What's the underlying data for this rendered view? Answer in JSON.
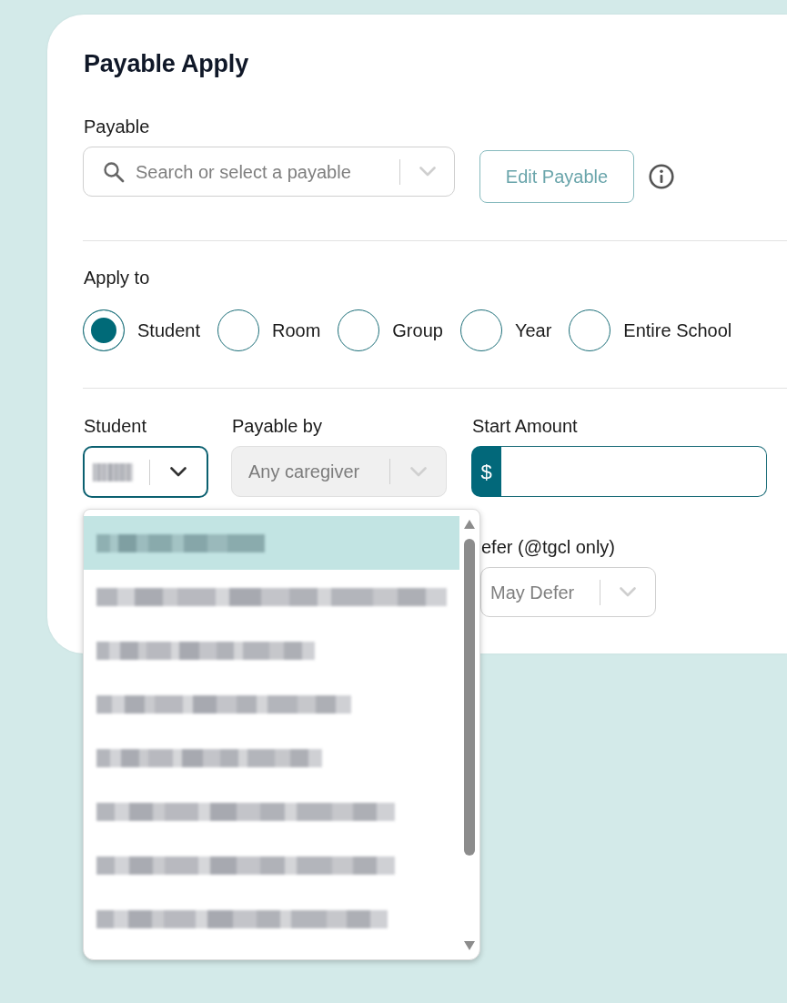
{
  "title": "Payable Apply",
  "payable": {
    "label": "Payable",
    "placeholder": "Search or select a payable",
    "edit_button": "Edit Payable"
  },
  "apply_to": {
    "label": "Apply to",
    "options": [
      {
        "label": "Student",
        "selected": true
      },
      {
        "label": "Room",
        "selected": false
      },
      {
        "label": "Group",
        "selected": false
      },
      {
        "label": "Year",
        "selected": false
      },
      {
        "label": "Entire School",
        "selected": false
      }
    ]
  },
  "student": {
    "label": "Student",
    "redacted": true,
    "expanded": true,
    "options": [
      {
        "selected": true
      },
      {
        "selected": false
      },
      {
        "selected": false
      },
      {
        "selected": false
      },
      {
        "selected": false
      },
      {
        "selected": false
      },
      {
        "selected": false
      },
      {
        "selected": false
      }
    ]
  },
  "payable_by": {
    "label": "Payable by",
    "value": "Any caregiver",
    "disabled": true
  },
  "start_amount": {
    "label": "Start Amount",
    "prefix": "$"
  },
  "defer": {
    "label": "efer (@tgcl only)",
    "value": "May Defer"
  }
}
